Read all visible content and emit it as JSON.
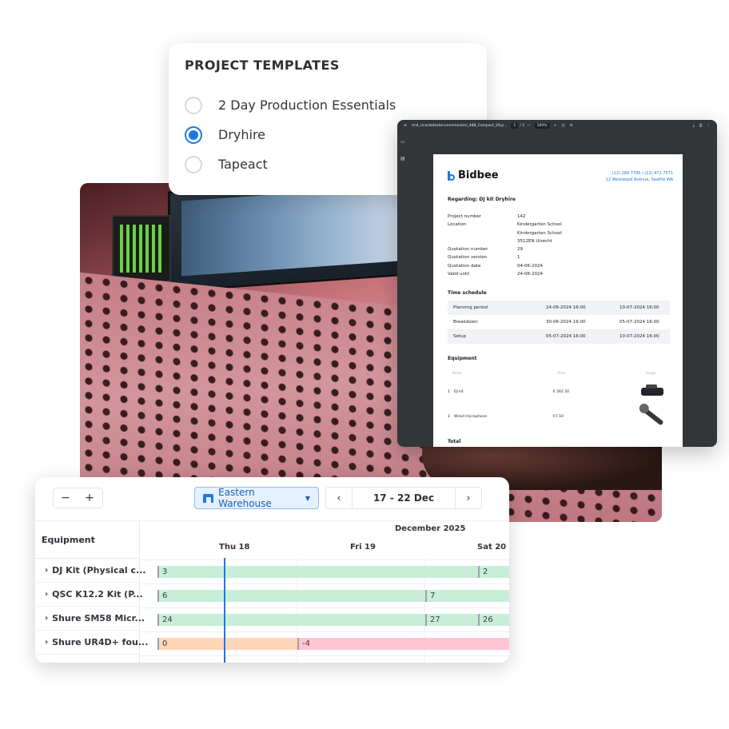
{
  "templates": {
    "title": "PROJECT TEMPLATES",
    "options": [
      {
        "label": "2 Day Production Essentials",
        "selected": false
      },
      {
        "label": "Dryhire",
        "selected": true
      },
      {
        "label": "Tapeact",
        "selected": false
      }
    ]
  },
  "pdf": {
    "toolbar": {
      "filename": "rm4_ricardotestenvironmenten_488_Compact_29.p...",
      "page": "1",
      "page_total": "/ 2",
      "zoom_minus": "—",
      "zoom": "100%",
      "zoom_plus": "+"
    },
    "brand": "Bidbee",
    "contact_phone": "(12) 284 7795 / (12) 471 7571",
    "contact_address": "12 Westwood Avenue, Seattle WA",
    "regarding": "Regarding: DJ kit Dryhire",
    "details": [
      {
        "k": "Project number",
        "v": "142"
      },
      {
        "k": "Location",
        "v": "Kindergarten School"
      },
      {
        "k": "",
        "v": "Kindergarten School"
      },
      {
        "k": "",
        "v": "3512EN Utrecht"
      },
      {
        "k": "Quotation number",
        "v": "29"
      },
      {
        "k": "Quotation version",
        "v": "1"
      },
      {
        "k": "Quotation date",
        "v": "04-06-2024"
      },
      {
        "k": "Valid until",
        "v": "24-06-2024"
      }
    ],
    "time_schedule_title": "Time schedule",
    "schedule": [
      {
        "name": "Planning period",
        "start": "24-06-2024 16:00",
        "end": "10-07-2024 16:00"
      },
      {
        "name": "Breakdown",
        "start": "30-06-2024 16:00",
        "end": "05-07-2024 16:00"
      },
      {
        "name": "Setup",
        "start": "05-07-2024 16:00",
        "end": "10-07-2024 16:00"
      }
    ],
    "equipment_title": "Equipment",
    "equip_head": {
      "name": "Name",
      "price": "Price",
      "image": "Image"
    },
    "equipment": [
      {
        "qty": "1",
        "name": "DJ kit",
        "price": "€ 262.50"
      },
      {
        "qty": "1",
        "name": "Wired microphone",
        "price": "€7.50"
      }
    ],
    "total_title": "Total"
  },
  "planner": {
    "zoom_minus": "−",
    "zoom_plus": "+",
    "warehouse": "Eastern Warehouse",
    "prev": "‹",
    "next": "›",
    "date_range": "17 - 22 Dec",
    "equipment_header": "Equipment",
    "month": "December 2025",
    "days": [
      "Thu 18",
      "Fri 19",
      "Sat 20"
    ],
    "rows": [
      {
        "name": "DJ Kit (Physical c..."
      },
      {
        "name": "QSC K12.2 Kit (P..."
      },
      {
        "name": "Shure SM58 Micr..."
      },
      {
        "name": "Shure UR4D+ fou..."
      }
    ],
    "bars": [
      [
        {
          "label": "3",
          "color": "green"
        },
        {
          "label": "2",
          "color": "green"
        }
      ],
      [
        {
          "label": "6",
          "color": "green"
        },
        {
          "label": "7",
          "color": "green"
        }
      ],
      [
        {
          "label": "24",
          "color": "green"
        },
        {
          "label": "27",
          "color": "green"
        },
        {
          "label": "26",
          "color": "green"
        }
      ],
      [
        {
          "label": "0",
          "color": "orange"
        },
        {
          "label": "-4",
          "color": "pink"
        }
      ]
    ],
    "colors": {
      "accent": "#1c77e6",
      "available": "#c8eed8",
      "low": "#ffd6b8",
      "shortage": "#ffc5d3"
    }
  }
}
